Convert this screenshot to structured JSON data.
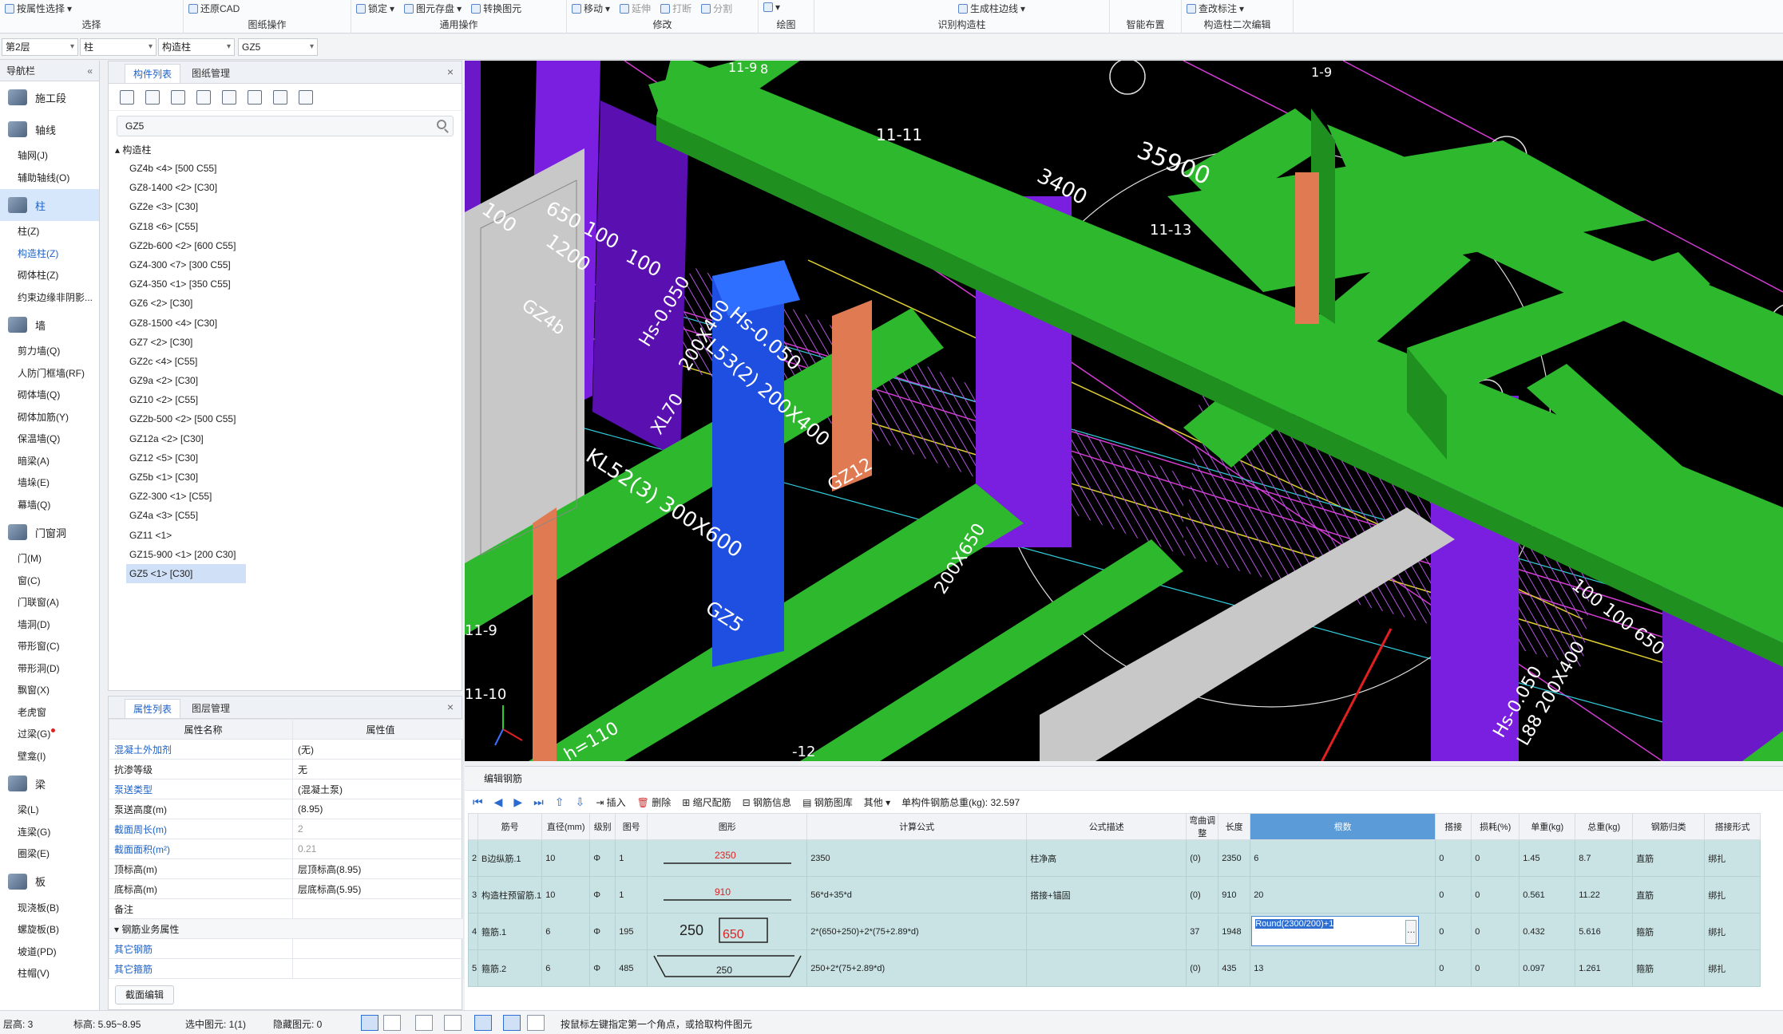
{
  "ribbon": {
    "groups": [
      {
        "buttons": [
          "按属性选择"
        ],
        "caption": "选择"
      },
      {
        "buttons": [
          "还原CAD"
        ],
        "caption": "图纸操作"
      },
      {
        "buttons": [
          "锁定",
          "图元存盘",
          "转换图元"
        ],
        "caption": "通用操作"
      },
      {
        "buttons": [
          "移动",
          "延伸",
          "打断",
          "分割"
        ],
        "caption": "修改"
      },
      {
        "buttons": [],
        "caption": "绘图"
      },
      {
        "buttons": [
          "生成柱边线"
        ],
        "caption": "识别构造柱"
      },
      {
        "buttons": [],
        "caption": "智能布置"
      },
      {
        "buttons": [
          "查改标注"
        ],
        "caption": "构造柱二次编辑"
      }
    ]
  },
  "selectors": {
    "floor": "第2层",
    "category": "柱",
    "subtype": "构造柱",
    "component": "GZ5"
  },
  "nav": {
    "title": "导航栏",
    "items": [
      {
        "type": "cat",
        "label": "施工段"
      },
      {
        "type": "cat",
        "label": "轴线"
      },
      {
        "type": "item",
        "label": "轴网(J)"
      },
      {
        "type": "item",
        "label": "辅助轴线(O)"
      },
      {
        "type": "cat",
        "label": "柱",
        "active": true
      },
      {
        "type": "item",
        "label": "柱(Z)"
      },
      {
        "type": "item",
        "label": "构造柱(Z)",
        "active": true
      },
      {
        "type": "item",
        "label": "砌体柱(Z)"
      },
      {
        "type": "item",
        "label": "约束边缘非阴影..."
      },
      {
        "type": "cat",
        "label": "墙"
      },
      {
        "type": "item",
        "label": "剪力墙(Q)"
      },
      {
        "type": "item",
        "label": "人防门框墙(RF)"
      },
      {
        "type": "item",
        "label": "砌体墙(Q)"
      },
      {
        "type": "item",
        "label": "砌体加筋(Y)"
      },
      {
        "type": "item",
        "label": "保温墙(Q)"
      },
      {
        "type": "item",
        "label": "暗梁(A)"
      },
      {
        "type": "item",
        "label": "墙垛(E)"
      },
      {
        "type": "item",
        "label": "幕墙(Q)"
      },
      {
        "type": "cat",
        "label": "门窗洞"
      },
      {
        "type": "item",
        "label": "门(M)"
      },
      {
        "type": "item",
        "label": "窗(C)"
      },
      {
        "type": "item",
        "label": "门联窗(A)"
      },
      {
        "type": "item",
        "label": "墙洞(D)"
      },
      {
        "type": "item",
        "label": "带形窗(C)"
      },
      {
        "type": "item",
        "label": "带形洞(D)"
      },
      {
        "type": "item",
        "label": "飘窗(X)"
      },
      {
        "type": "item",
        "label": "老虎窗"
      },
      {
        "type": "item",
        "label": "过梁(G)",
        "dot": true
      },
      {
        "type": "item",
        "label": "壁龛(I)"
      },
      {
        "type": "cat",
        "label": "梁"
      },
      {
        "type": "item",
        "label": "梁(L)"
      },
      {
        "type": "item",
        "label": "连梁(G)"
      },
      {
        "type": "item",
        "label": "圈梁(E)"
      },
      {
        "type": "cat",
        "label": "板"
      },
      {
        "type": "item",
        "label": "现浇板(B)"
      },
      {
        "type": "item",
        "label": "螺旋板(B)"
      },
      {
        "type": "item",
        "label": "坡道(PD)"
      },
      {
        "type": "item",
        "label": "柱帽(V)"
      }
    ]
  },
  "complist": {
    "tabs": [
      "构件列表",
      "图纸管理"
    ],
    "search": "GZ5",
    "root": "构造柱",
    "items": [
      "GZ4b <4> [500 C55]",
      "GZ8-1400 <2> [C30]",
      "GZ2e <3> [C30]",
      "GZ18 <6> [C55]",
      "GZ2b-600 <2> [600 C55]",
      "GZ4-300 <7> [300 C55]",
      "GZ4-350 <1> [350 C55]",
      "GZ6 <2> [C30]",
      "GZ8-1500 <4> [C30]",
      "GZ7 <2> [C30]",
      "GZ2c <4> [C55]",
      "GZ9a <2> [C30]",
      "GZ10 <2> [C55]",
      "GZ2b-500 <2> [500 C55]",
      "GZ12a <2> [C30]",
      "GZ12 <5> [C30]",
      "GZ5b <1> [C30]",
      "GZ2-300 <1> [C55]",
      "GZ4a <3> [C55]",
      "GZ11 <1>",
      "GZ15-900 <1> [200 C30]",
      "GZ5 <1> [C30]"
    ]
  },
  "props": {
    "tabs": [
      "属性列表",
      "图层管理"
    ],
    "col_name": "属性名称",
    "col_value": "属性值",
    "rows": [
      {
        "name": "混凝土外加剂",
        "value": "(无)",
        "blue": true
      },
      {
        "name": "抗渗等级",
        "value": "无"
      },
      {
        "name": "泵送类型",
        "value": "(混凝土泵)",
        "blue": true
      },
      {
        "name": "泵送高度(m)",
        "value": "(8.95)"
      },
      {
        "name": "截面周长(m)",
        "value": "2",
        "blue": true,
        "grey": true
      },
      {
        "name": "截面面积(m²)",
        "value": "0.21",
        "blue": true,
        "grey": true
      },
      {
        "name": "顶标高(m)",
        "value": "层顶标高(8.95)"
      },
      {
        "name": "底标高(m)",
        "value": "层底标高(5.95)"
      },
      {
        "name": "备注",
        "value": ""
      }
    ],
    "section": "钢筋业务属性",
    "rows2": [
      {
        "name": "其它钢筋",
        "value": "",
        "blue": true
      },
      {
        "name": "其它箍筋",
        "value": "",
        "blue": true
      }
    ],
    "button": "截面编辑"
  },
  "viewport": {
    "labels": [
      "35900",
      "3400",
      "650 100",
      "100",
      "11-11",
      "11-13",
      "11-9",
      "100",
      "1200",
      "GZ4b",
      "Hs-0.050",
      "200X400",
      "XL70",
      "Hs-0.050",
      "L53(2) 200X400",
      "KL52(3) 300X600",
      "GZ5",
      "200X650",
      "GZ12",
      "100 100 650",
      "Hs-0.050",
      "L88 200X400",
      "11-9",
      "11-10",
      "h=110",
      "-12",
      "8",
      "1-9"
    ]
  },
  "rebar": {
    "title": "编辑钢筋",
    "tools": [
      "插入",
      "删除",
      "缩尺配筋",
      "钢筋信息",
      "钢筋图库",
      "其他"
    ],
    "total_label": "单构件钢筋总重(kg): 32.597",
    "headers": [
      "筋号",
      "直径(mm)",
      "级别",
      "图号",
      "图形",
      "计算公式",
      "公式描述",
      "弯曲调整",
      "长度",
      "根数",
      "搭接",
      "损耗(%)",
      "单重(kg)",
      "总重(kg)",
      "钢筋归类",
      "搭接形式"
    ],
    "rows": [
      {
        "idx": "2",
        "name": "B边纵筋.1",
        "dia": "10",
        "grade": "Φ",
        "fig": "1",
        "shape_text": "2350",
        "formula": "2350",
        "desc": "柱净高",
        "bend": "(0)",
        "len": "2350",
        "count": "6",
        "lap": "0",
        "loss": "0",
        "unit": "1.45",
        "total": "8.7",
        "cat": "直筋",
        "laptype": "绑扎"
      },
      {
        "idx": "3",
        "name": "构造柱预留筋.1",
        "dia": "10",
        "grade": "Φ",
        "fig": "1",
        "shape_text": "910",
        "formula": "56*d+35*d",
        "desc": "搭接+锚固",
        "bend": "(0)",
        "len": "910",
        "count": "20",
        "lap": "0",
        "loss": "0",
        "unit": "0.561",
        "total": "11.22",
        "cat": "直筋",
        "laptype": "绑扎"
      },
      {
        "idx": "4",
        "name": "箍筋.1",
        "dia": "6",
        "grade": "Φ",
        "fig": "195",
        "shape_text": "250",
        "shape_text2": "650",
        "formula": "2*(650+250)+2*(75+2.89*d)",
        "desc": "",
        "bend": "37",
        "len": "1948",
        "count": "Round(2300/200)+1",
        "lap": "0",
        "loss": "0",
        "unit": "0.432",
        "total": "5.616",
        "cat": "箍筋",
        "laptype": "绑扎"
      },
      {
        "idx": "5",
        "name": "箍筋.2",
        "dia": "6",
        "grade": "Φ",
        "fig": "485",
        "shape_text": "250",
        "formula": "250+2*(75+2.89*d)",
        "desc": "",
        "bend": "(0)",
        "len": "435",
        "count": "13",
        "lap": "0",
        "loss": "0",
        "unit": "0.097",
        "total": "1.261",
        "cat": "箍筋",
        "laptype": "绑扎"
      }
    ]
  },
  "status": {
    "floor_h": "层高:  3",
    "elev": "标高:  5.95~8.95",
    "selected": "选中图元: 1(1)",
    "hidden": "隐藏图元: 0",
    "hint": "按鼠标左键指定第一个角点，或拾取构件图元"
  },
  "colors": {
    "beam": "#2eb82e",
    "column": "#7a1fe0",
    "gz": "#e07a52",
    "wall": "#c8c8c8",
    "accent": "#1d62c8",
    "selected_col": "#1f4fe0"
  }
}
